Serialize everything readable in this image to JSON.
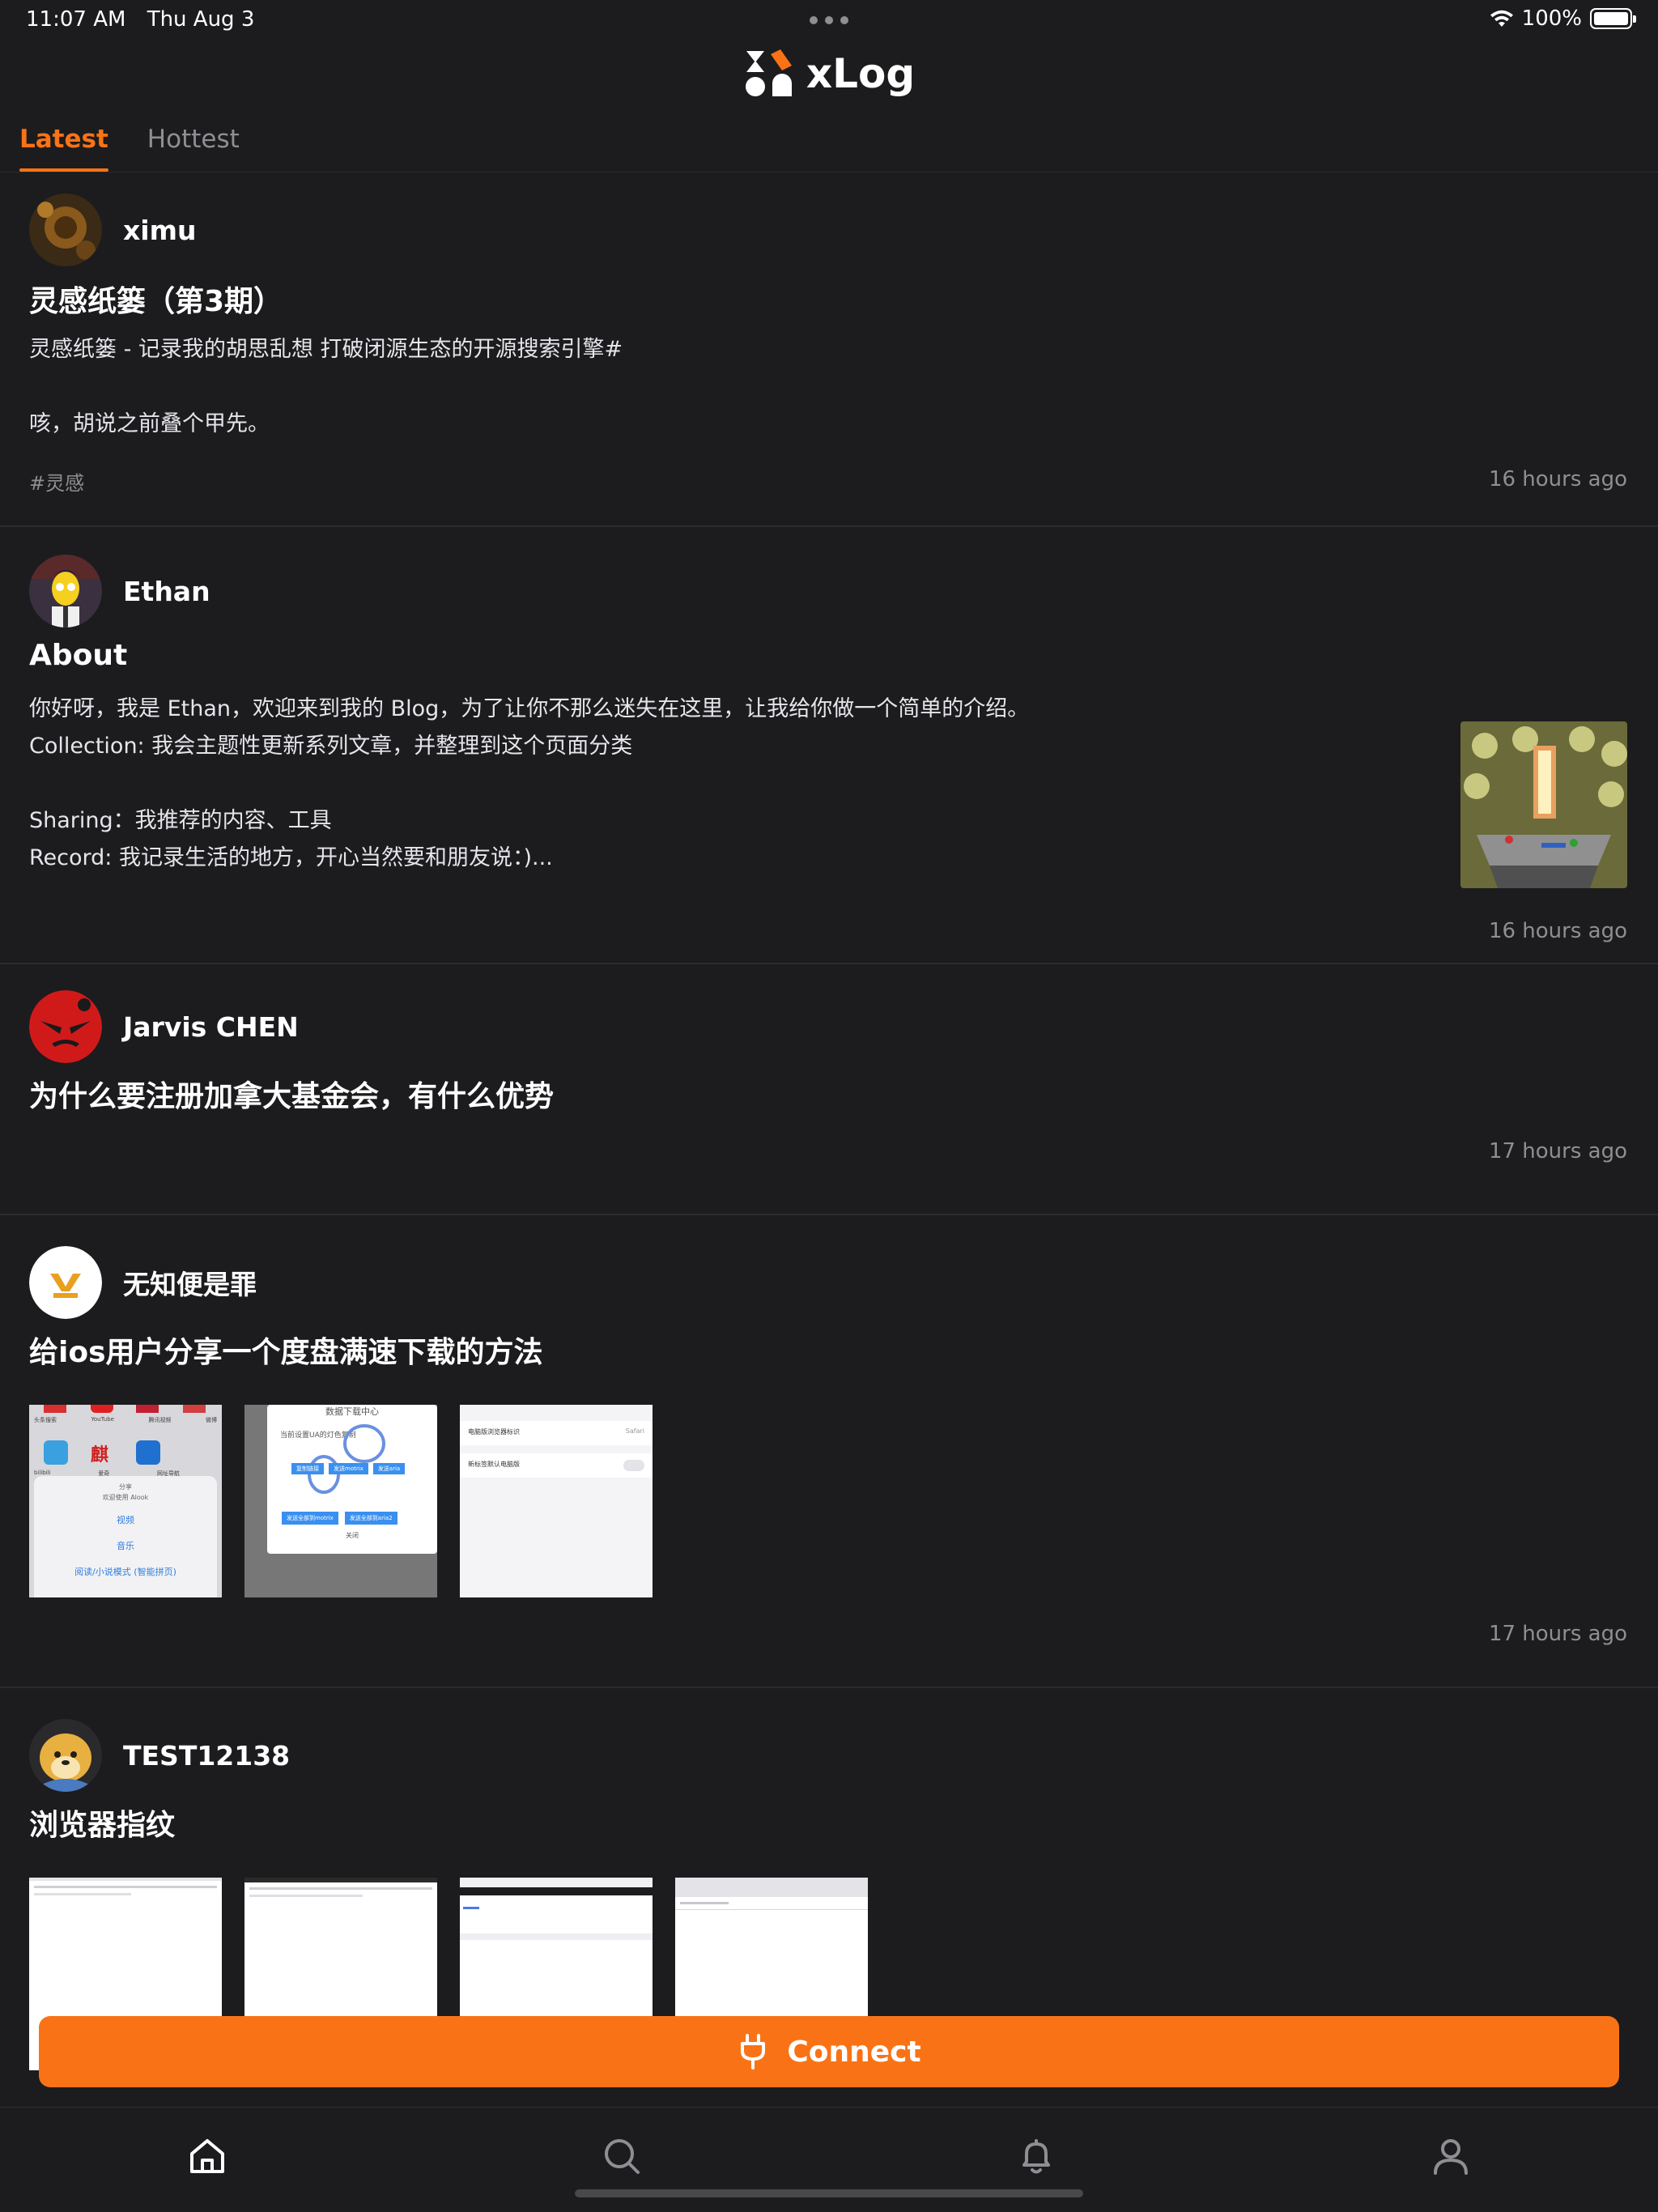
{
  "status_bar": {
    "time": "11:07 AM",
    "date": "Thu Aug 3",
    "battery": "100%"
  },
  "header": {
    "title": "xLog"
  },
  "tabs": [
    {
      "label": "Latest",
      "active": true
    },
    {
      "label": "Hottest",
      "active": false
    }
  ],
  "posts": [
    {
      "author": "ximu",
      "title": "灵感纸篓（第3期）",
      "excerpt_lines": [
        "灵感纸篓 - 记录我的胡思乱想 打破闭源生态的开源搜索引擎#",
        "",
        "咳，胡说之前叠个甲先。"
      ],
      "tag": "#灵感",
      "time": "16 hours ago"
    },
    {
      "author": "Ethan",
      "title": "About",
      "excerpt_lines": [
        "你好呀，我是 Ethan，欢迎来到我的 Blog，为了让你不那么迷失在这里，让我给你做一个简单的介绍。",
        "Collection: 我会主题性更新系列文章，并整理到这个页面分类",
        "",
        "Sharing：我推荐的内容、工具",
        "Record: 我记录生活的地方，开心当然要和朋友说：)..."
      ],
      "time": "16 hours ago"
    },
    {
      "author": "Jarvis CHEN",
      "title": "为什么要注册加拿大基金会，有什么优势",
      "time": "17 hours ago"
    },
    {
      "author": "无知便是罪",
      "title": "给ios用户分享一个度盘满速下载的方法",
      "time": "17 hours ago",
      "screenshots": {
        "shot1": {
          "apps": [
            "头条搜索",
            "YouTube",
            "腾讯视频",
            "微博"
          ],
          "apps2": [
            "bilibili",
            "爱奇",
            "网址导航"
          ],
          "sheet_title": "分享",
          "sheet_sub": "欢迎使用 Alook",
          "actions": [
            "视频",
            "音乐",
            "阅读/小说模式 (智能拼页)"
          ]
        },
        "shot2": {
          "title": "数据下载中心",
          "text": "当前设置UA的灯色复制",
          "btn1": "复制链接",
          "btn2": "发送motrix",
          "btn3": "发送aria",
          "btn4": "发送全部到motrix",
          "btn5": "发送全部到aria2",
          "close": "关闭"
        },
        "shot3": {
          "row1": "电脑版浏览器标识",
          "row1_value": "Safari",
          "row2": "新标签默认电脑版"
        }
      }
    },
    {
      "author": "TEST12138",
      "title": "浏览器指纹"
    }
  ],
  "connect": {
    "label": "Connect"
  },
  "nav": [
    "home-icon",
    "search-icon",
    "bell-icon",
    "profile-icon"
  ]
}
